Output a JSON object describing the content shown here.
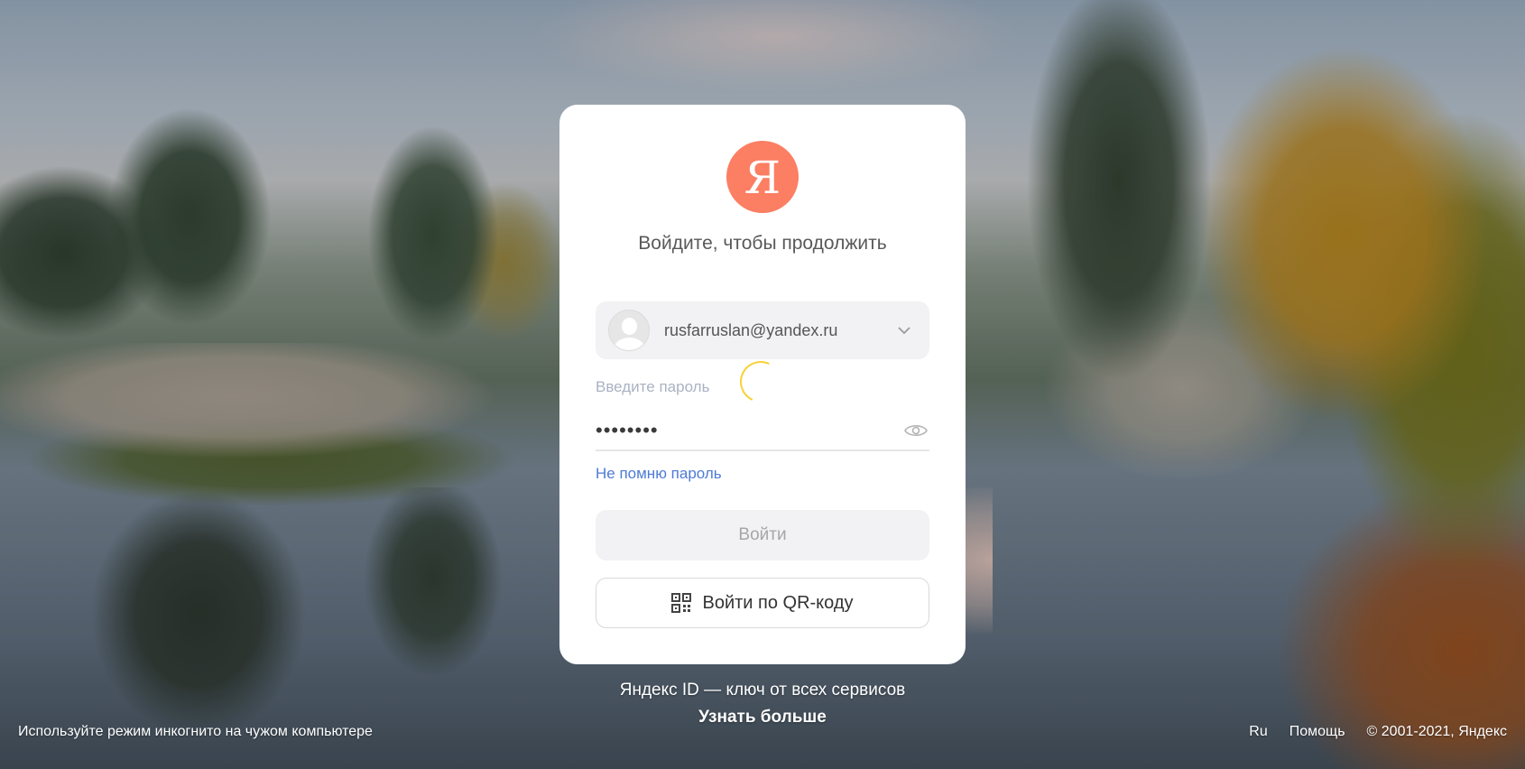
{
  "colors": {
    "brand": "#fc7e63",
    "link": "#4e7bd6",
    "spinner": "#f7d23a"
  },
  "logo": {
    "glyph": "Я",
    "icon": "yandex-logo-icon"
  },
  "card": {
    "subtitle": "Войдите, чтобы продолжить",
    "account": {
      "login": "rusfarruslan@yandex.ru",
      "avatar_icon": "user-avatar-icon",
      "chevron_icon": "chevron-down-icon"
    },
    "password": {
      "label": "Введите пароль",
      "value": "••••••••",
      "toggle_icon": "eye-icon"
    },
    "forgot_label": "Не помню пароль",
    "login_button": "Войти",
    "qr_button": "Войти по QR-коду",
    "qr_icon": "qr-code-icon"
  },
  "promo": {
    "text": "Яндекс ID — ключ от всех сервисов",
    "link": "Узнать больше"
  },
  "footer": {
    "left": "Используйте режим инкогнито на чужом компьютере",
    "lang": "Ru",
    "help": "Помощь",
    "copyright": "© 2001-2021, Яндекс"
  }
}
